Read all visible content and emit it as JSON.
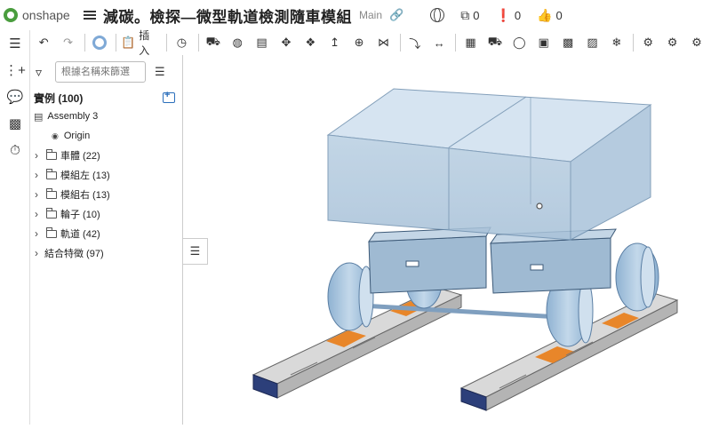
{
  "app": {
    "logo_text": "onshape"
  },
  "document": {
    "title": "減碳。檢探—微型軌道檢測隨車模組",
    "branch": "Main"
  },
  "header_stats": {
    "copies": "0",
    "branches": "0",
    "likes": "0"
  },
  "toolbar": {
    "insert_label": "插入"
  },
  "panel": {
    "search_placeholder": "根據名稱來篩選",
    "instances_label": "實例 (100)",
    "assembly_label": "Assembly 3",
    "origin_label": "Origin",
    "folders": [
      {
        "label": "車體 (22)"
      },
      {
        "label": "模組左 (13)"
      },
      {
        "label": "模組右 (13)"
      },
      {
        "label": "輪子 (10)"
      },
      {
        "label": "軌道 (42)"
      }
    ],
    "mates_label": "結合特徵 (97)"
  },
  "colors": {
    "brand": "#4a9d3e",
    "part_blue": "#9ec0dc",
    "rail_gray": "#c9c9c9",
    "rail_orange": "#e8862a",
    "rail_navy": "#2c3f7a"
  }
}
